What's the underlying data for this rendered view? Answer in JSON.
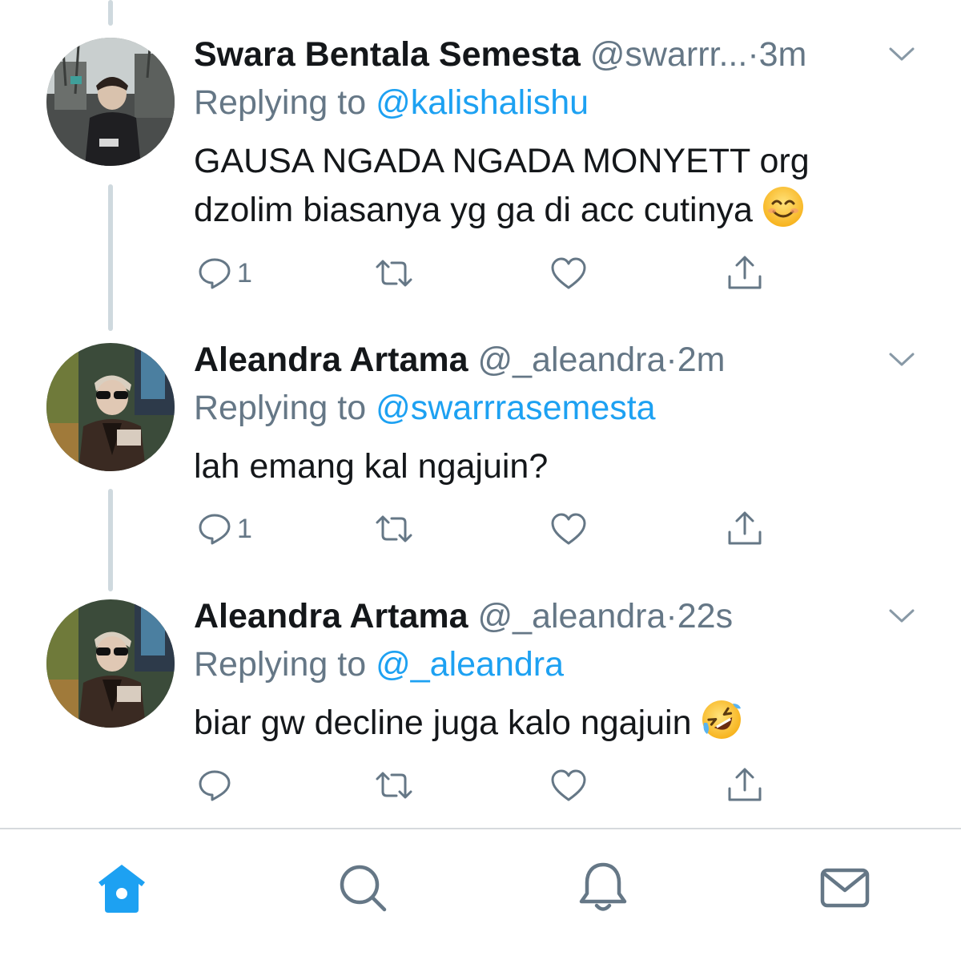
{
  "colors": {
    "accent": "#1da1f2",
    "secondary_text": "#657786",
    "primary_text": "#14171a",
    "thread_line": "#cfd9de"
  },
  "tweets": [
    {
      "name": "Swara Bentala Semesta",
      "handle": "@swarrr...",
      "time": "3m",
      "replying_prefix": "Replying to",
      "replying_to": "@kalishalishu",
      "text": "GAUSA NGADA NGADA MONYETT org dzolim biasanya yg ga di acc cutinya",
      "emoji": "smiling-face-emoji",
      "reply_count": "1",
      "avatar": "profile-photo-street-trees"
    },
    {
      "name": "Aleandra Artama",
      "handle": "@_aleandra",
      "time": "2m",
      "replying_prefix": "Replying to",
      "replying_to": "@swarrrasemesta",
      "text": "lah emang kal ngajuin?",
      "reply_count": "1",
      "avatar": "profile-photo-sunglasses"
    },
    {
      "name": "Aleandra Artama",
      "handle": "@_aleandra",
      "time": "22s",
      "replying_prefix": "Replying to",
      "replying_to": "@_aleandra",
      "text": "biar gw decline juga kalo ngajuin",
      "emoji": "rolling-on-floor-laughing-emoji",
      "reply_count": "",
      "avatar": "profile-photo-sunglasses"
    }
  ],
  "separator": "·",
  "tabbar": {
    "items": [
      "home-icon",
      "search-icon",
      "notifications-icon",
      "messages-icon"
    ],
    "active": "home-icon"
  }
}
